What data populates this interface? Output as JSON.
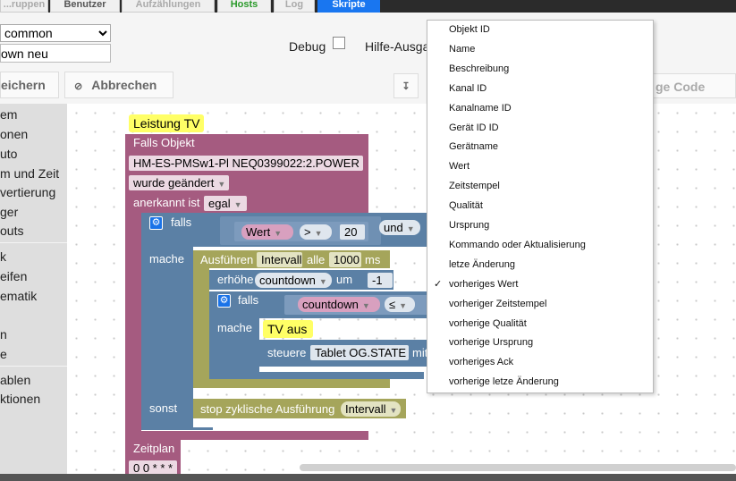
{
  "tabs": [
    {
      "label": "...ruppen",
      "style": "muted"
    },
    {
      "label": "Benutzer",
      "style": "normal"
    },
    {
      "label": "Aufzählungen",
      "style": "muted"
    },
    {
      "label": "Hosts",
      "style": "green"
    },
    {
      "label": "Log",
      "style": "muted"
    },
    {
      "label": "Skripte",
      "style": "active"
    }
  ],
  "toolbar": {
    "engine_select": "common",
    "script_name": "own neu",
    "debug_label": "Debug",
    "help_label": "Hilfe-Ausga",
    "save_label": "eichern",
    "cancel_label": "Abbrechen",
    "cancel_icon": "⊘",
    "export_icon": "↧",
    "code_label": "ge Code"
  },
  "sidebar": {
    "items": [
      "em",
      "onen",
      "uto",
      "m und Zeit",
      "vertierung",
      "ger",
      "outs",
      "k",
      "eifen",
      "ematik",
      "",
      "n",
      "e",
      "ablen",
      "ktionen"
    ]
  },
  "blocks": {
    "title_comment": "Leistung TV",
    "falls_objekt": "Falls Objekt",
    "object_id": "HM-ES-PMSw1-Pl NEQ0399022:2.POWER",
    "wurde": "wurde geändert",
    "anerkannt": "anerkannt ist",
    "egal": "egal",
    "falls": "falls",
    "wert": "Wert",
    "gt": ">",
    "num20": "20",
    "und": "und",
    "mache": "mache",
    "ausfuehren": "Ausführen",
    "intervall": "Intervall",
    "alle": "alle",
    "ms_value": "1000",
    "ms": "ms",
    "erhoehe": "erhöhe",
    "countdown": "countdown",
    "um": "um",
    "minus_one": "-1",
    "falls2": "falls",
    "countdown2": "countdown",
    "le": "≤",
    "mache2": "mache",
    "tv_aus": "TV aus",
    "steuere": "steuere",
    "tablet": "Tablet OG.STATE",
    "mit": "mit",
    "sonst": "sonst",
    "stop": "stop zyklische Ausführung",
    "intervall2": "Intervall",
    "zeitplan": "Zeitplan",
    "cron": "0 0 * * *"
  },
  "menu": {
    "items": [
      "Objekt ID",
      "Name",
      "Beschreibung",
      "Kanal ID",
      "Kanalname ID",
      "Gerät ID ID",
      "Gerätname",
      "Wert",
      "Zeitstempel",
      "Qualität",
      "Ursprung",
      "Kommando oder Aktualisierung",
      "letze Änderung",
      "vorheriges Wert",
      "vorheriger Zeitstempel",
      "vorherige Qualität",
      "vorherige Ursprung",
      "vorheriges Ack",
      "vorherige letze Änderung"
    ],
    "checked_item": "vorheriges Wert",
    "check_mark": "✓"
  },
  "colors": {
    "event_block": "#a55b80",
    "logic_block": "#5b80a5",
    "timer_block": "#a5a55b",
    "comment": "#ffff66",
    "active_tab": "#1976f0"
  }
}
